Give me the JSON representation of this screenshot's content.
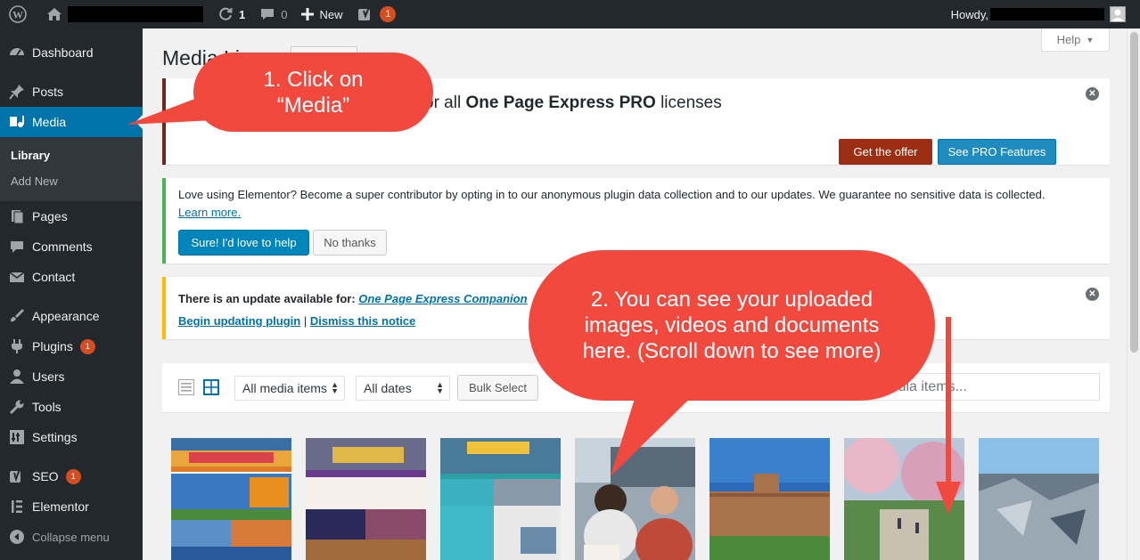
{
  "adminbar": {
    "updates_count": "1",
    "comments_count": "0",
    "new_label": "New",
    "yoast_count": "1",
    "howdy_label": "Howdy,"
  },
  "sidebar": {
    "items": [
      {
        "label": "Dashboard",
        "icon": "dashboard-icon"
      },
      {
        "label": "Posts",
        "icon": "pin-icon"
      },
      {
        "label": "Media",
        "icon": "media-icon"
      },
      {
        "label": "Pages",
        "icon": "pages-icon"
      },
      {
        "label": "Comments",
        "icon": "comment-icon"
      },
      {
        "label": "Contact",
        "icon": "mail-icon"
      },
      {
        "label": "Appearance",
        "icon": "brush-icon"
      },
      {
        "label": "Plugins",
        "icon": "plugin-icon",
        "badge": "1"
      },
      {
        "label": "Users",
        "icon": "user-icon"
      },
      {
        "label": "Tools",
        "icon": "wrench-icon"
      },
      {
        "label": "Settings",
        "icon": "settings-icon"
      },
      {
        "label": "SEO",
        "icon": "yoast-icon",
        "badge": "1"
      },
      {
        "label": "Elementor",
        "icon": "elementor-icon"
      },
      {
        "label": "Collapse menu",
        "icon": "collapse-icon"
      }
    ],
    "media_submenu": [
      "Library",
      "Add New"
    ]
  },
  "main": {
    "help_label": "Help",
    "title": "Media Li",
    "promo": {
      "text_before": "or all ",
      "text_bold": "One Page Express PRO",
      "text_after": " licenses",
      "offer_label": "Get the offer",
      "pro_label": "See PRO Features"
    },
    "elementor": {
      "text": "Love using Elementor? Become a super contributor by opting in to our anonymous plugin data collection and to our updates. We guarantee no sensitive data is collected.",
      "learn_more": "Learn more.",
      "yes_label": "Sure! I'd love to help",
      "no_label": "No thanks"
    },
    "update": {
      "line1_prefix": "There is an update available for: ",
      "plugin_link": "One Page Express Companion",
      "begin_link": "Begin updating plugin",
      "separator": " | ",
      "dismiss_link": "Dismiss this notice"
    },
    "toolbar": {
      "type_filter": "All media items",
      "date_filter": "All dates",
      "bulk_label": "Bulk Select",
      "search_placeholder": "ch media items..."
    }
  },
  "callouts": {
    "one": "1.  Click on\n“Media”",
    "two": "2.  You can see your uploaded images, videos and documents here. (Scroll down to see more)"
  },
  "colors": {
    "adminbar": "#23282d",
    "accent": "#0073aa",
    "callout": "#f2493f",
    "offer_button": "#9c2f13",
    "success_border": "#46b450",
    "warning_border": "#ffb900"
  }
}
